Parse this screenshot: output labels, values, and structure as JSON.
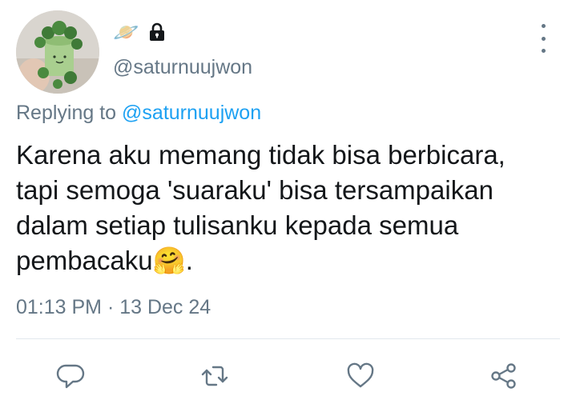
{
  "header": {
    "planet_emoji": "🪐",
    "lock_icon": "lock-icon",
    "handle": "@saturnuujwon",
    "more_icon": "more-vertical-icon"
  },
  "reply": {
    "prefix": "Replying to",
    "mention": "@saturnuujwon"
  },
  "tweet": {
    "text": "Karena aku memang tidak bisa berbicara,\ntapi semoga 'suaraku' bisa tersampaikan\ndalam setiap tulisanku kepada semua\npembacaku🤗.",
    "timestamp": "01:13 PM · 13 Dec 24"
  },
  "actions": {
    "reply_icon": "reply-icon",
    "retweet_icon": "retweet-icon",
    "like_icon": "like-icon",
    "share_icon": "share-icon"
  },
  "colors": {
    "text": "#14171a",
    "secondary": "#657786",
    "link": "#1da1f2",
    "divider": "#e1e8ed"
  }
}
